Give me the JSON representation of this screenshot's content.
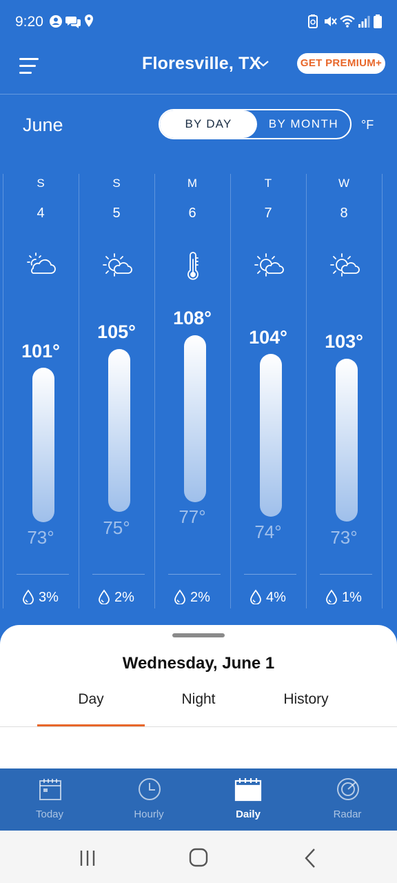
{
  "status_bar": {
    "time": "9:20"
  },
  "header": {
    "location": "Floresville, TX",
    "premium_label": "GET PREMIUM+"
  },
  "controls": {
    "month": "June",
    "by_day_label": "BY DAY",
    "by_month_label": "BY MONTH",
    "unit": "°F"
  },
  "days": [
    {
      "dow": "S",
      "date": "4",
      "icon": "partly-cloudy-icon",
      "high": "101°",
      "low": "73°",
      "precip": "3%"
    },
    {
      "dow": "S",
      "date": "5",
      "icon": "sun-cloud-icon",
      "high": "105°",
      "low": "75°",
      "precip": "2%"
    },
    {
      "dow": "M",
      "date": "6",
      "icon": "thermometer-icon",
      "high": "108°",
      "low": "77°",
      "precip": "2%"
    },
    {
      "dow": "T",
      "date": "7",
      "icon": "sun-cloud-icon",
      "high": "104°",
      "low": "74°",
      "precip": "4%"
    },
    {
      "dow": "W",
      "date": "8",
      "icon": "sun-cloud-icon",
      "high": "103°",
      "low": "73°",
      "precip": "1%"
    }
  ],
  "sheet": {
    "title": "Wednesday, June 1",
    "tabs": [
      "Day",
      "Night",
      "History"
    ],
    "active_tab": "Day"
  },
  "bottom_nav": [
    {
      "label": "Today",
      "icon": "calendar-today-icon"
    },
    {
      "label": "Hourly",
      "icon": "clock-icon"
    },
    {
      "label": "Daily",
      "icon": "calendar-icon",
      "active": true
    },
    {
      "label": "Radar",
      "icon": "radar-icon"
    }
  ],
  "colors": {
    "background": "#2a72d2",
    "accent": "#e8672a",
    "nav": "#2c69b6"
  }
}
